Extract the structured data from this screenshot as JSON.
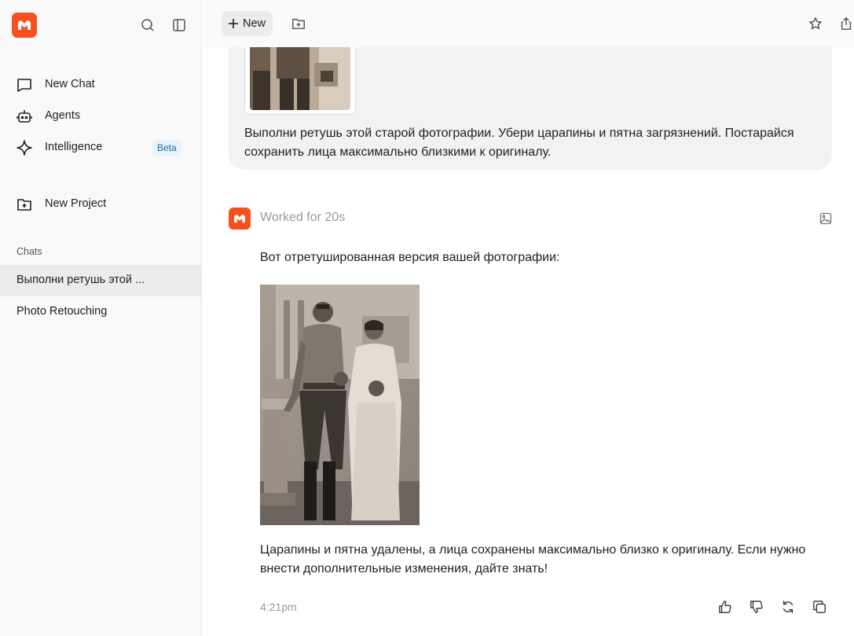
{
  "sidebar": {
    "nav": [
      {
        "label": "New Chat",
        "icon": "chat-bubble-icon"
      },
      {
        "label": "Agents",
        "icon": "robot-icon"
      },
      {
        "label": "Intelligence",
        "icon": "sparkle-icon",
        "badge": "Beta"
      },
      {
        "label": "New Project",
        "icon": "folder-plus-icon"
      }
    ],
    "chats_label": "Chats",
    "chats": [
      {
        "title": "Выполни ретушь этой ...",
        "active": true
      },
      {
        "title": "Photo Retouching",
        "active": false
      }
    ]
  },
  "topbar": {
    "new_label": "New"
  },
  "conversation": {
    "user_message": "Выполни ретушь этой старой фотографии. Убери царапины и пятна загрязнений. Постарайся сохранить лица максимально близкими к оригиналу.",
    "status": "Worked for 20s",
    "reply_intro": "Вот отретушированная версия вашей фотографии:",
    "reply_outro": "Царапины и пятна удалены, а лица сохранены максимально близко к оригиналу. Если нужно внести дополнительные изменения, дайте знать!",
    "timestamp": "4:21pm"
  },
  "colors": {
    "brand": "#f5511f",
    "badge_bg": "#e6f3fa",
    "badge_text": "#236a93"
  }
}
